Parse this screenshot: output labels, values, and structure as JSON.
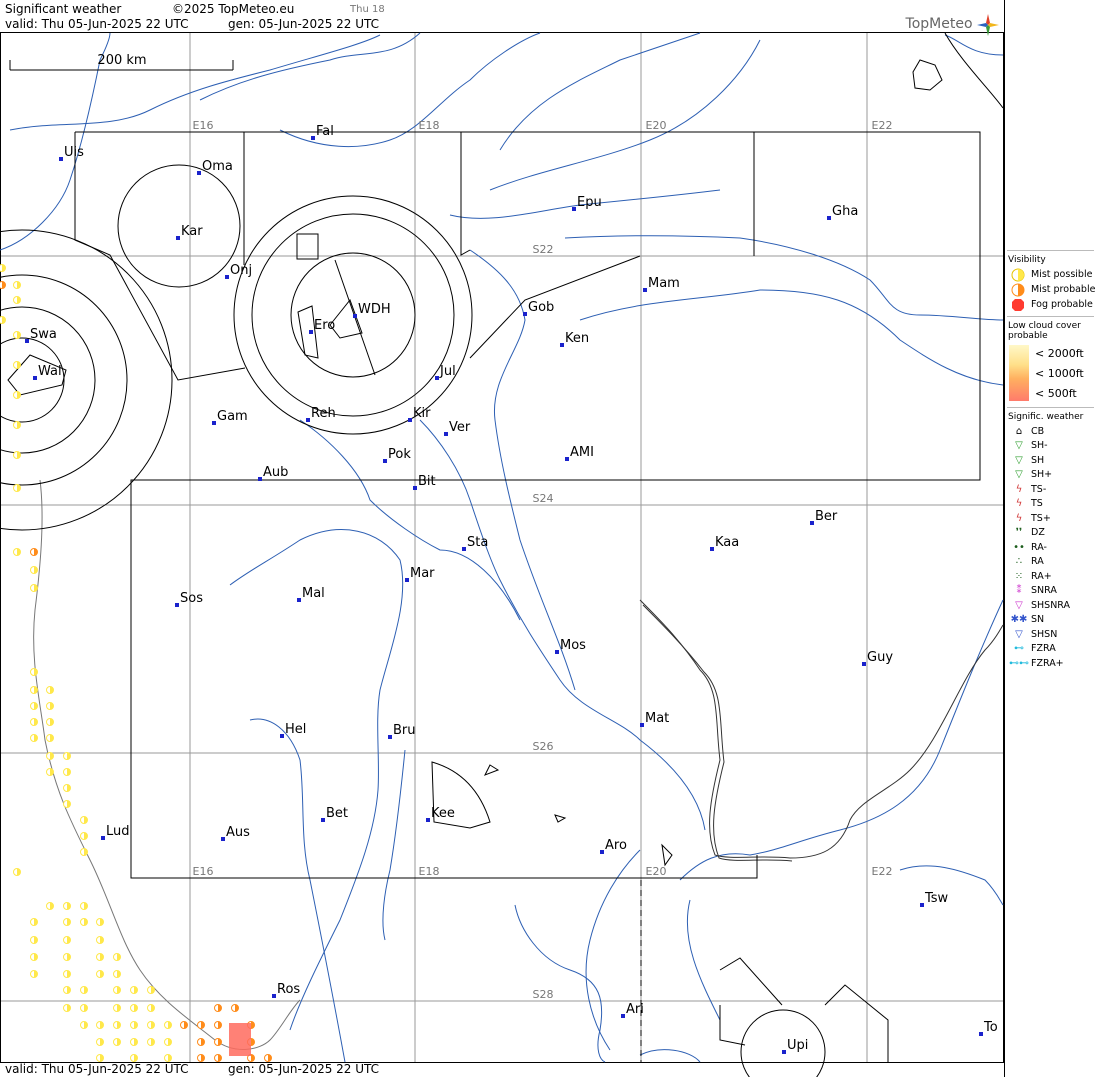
{
  "header": {
    "title": "Significant weather",
    "copyright": "©2025 TopMeteo.eu",
    "day_tag": "Thu 18",
    "valid": "valid:  Thu  05-Jun-2025  22 UTC",
    "gen": "gen: 05-Jun-2025 22 UTC",
    "logo": "TopMeteo"
  },
  "footer": {
    "valid": "valid:  Thu  05-Jun-2025  22 UTC",
    "gen": "gen: 05-Jun-2025 22 UTC"
  },
  "scale_bar": {
    "label": "200 km"
  },
  "grid_labels": {
    "lon_top": [
      "E16",
      "E18",
      "E20",
      "E22"
    ],
    "lon_bottom": [
      "E16",
      "E18",
      "E20",
      "E22"
    ],
    "lat": [
      "S22",
      "S24",
      "S26",
      "S28"
    ]
  },
  "cities": [
    "Uis",
    "Fal",
    "Oma",
    "Kar",
    "Onj",
    "Epu",
    "Gha",
    "Swa",
    "Wal",
    "WDH",
    "Ero",
    "Gob",
    "Mam",
    "Ken",
    "Jul",
    "Gam",
    "Reh",
    "Kir",
    "Ver",
    "Aub",
    "Pok",
    "Bit",
    "AMI",
    "Ber",
    "Kaa",
    "Sta",
    "Sos",
    "Mal",
    "Mar",
    "Mos",
    "Guy",
    "Hel",
    "Bru",
    "Mat",
    "Lud",
    "Aus",
    "Bet",
    "Kee",
    "Aro",
    "Tsw",
    "Ros",
    "Ari",
    "To",
    "Upi"
  ],
  "legend": {
    "visibility_title": "Visibility",
    "visibility": [
      {
        "label": "Mist possible",
        "color": "#ffe84a",
        "icon": "half-circle-yellow"
      },
      {
        "label": "Mist probable",
        "color": "#ff8c1a",
        "icon": "half-circle-orange"
      },
      {
        "label": "Fog probable",
        "color": "#ff3b30",
        "icon": "octagon-red"
      }
    ],
    "lowcloud_title": "Low cloud cover probable",
    "lowcloud": [
      "< 2000ft",
      "< 1000ft",
      "<   500ft"
    ],
    "sigwx_title": "Signific. weather",
    "sigwx": [
      {
        "label": "CB",
        "symbol": "⌂",
        "color": "#000000"
      },
      {
        "label": "SH-",
        "symbol": "▽",
        "color": "#2e9e2e"
      },
      {
        "label": "SH",
        "symbol": "▽",
        "color": "#2e9e2e"
      },
      {
        "label": "SH+",
        "symbol": "▽",
        "color": "#2e9e2e"
      },
      {
        "label": "TS-",
        "symbol": "ϟ",
        "color": "#d23b3b"
      },
      {
        "label": "TS",
        "symbol": "ϟ",
        "color": "#d23b3b"
      },
      {
        "label": "TS+",
        "symbol": "ϟ",
        "color": "#d23b3b"
      },
      {
        "label": "DZ",
        "symbol": "❜❜",
        "color": "#1c5e1c"
      },
      {
        "label": "RA-",
        "symbol": "••",
        "color": "#1c5e1c"
      },
      {
        "label": "RA",
        "symbol": "∴",
        "color": "#1c5e1c"
      },
      {
        "label": "RA+",
        "symbol": "⁙",
        "color": "#1c5e1c"
      },
      {
        "label": "SNRA",
        "symbol": "⁑",
        "color": "#cc33cc"
      },
      {
        "label": "SHSNRA",
        "symbol": "▽",
        "color": "#cc33cc"
      },
      {
        "label": "SN",
        "symbol": "✱✱",
        "color": "#3355cc"
      },
      {
        "label": "SHSN",
        "symbol": "▽",
        "color": "#3355cc"
      },
      {
        "label": "FZRA",
        "symbol": "⊷",
        "color": "#22bbdd"
      },
      {
        "label": "FZRA+",
        "symbol": "⊷⊷",
        "color": "#22bbdd"
      }
    ]
  },
  "colors": {
    "grid": "#999999",
    "river": "#2d5fb3",
    "airspace": "#000000",
    "city_dot": "#1a22cc",
    "mist_possible": "#ffe84a",
    "mist_probable": "#ff8c1a",
    "fog_probable": "#ff6b5e"
  }
}
